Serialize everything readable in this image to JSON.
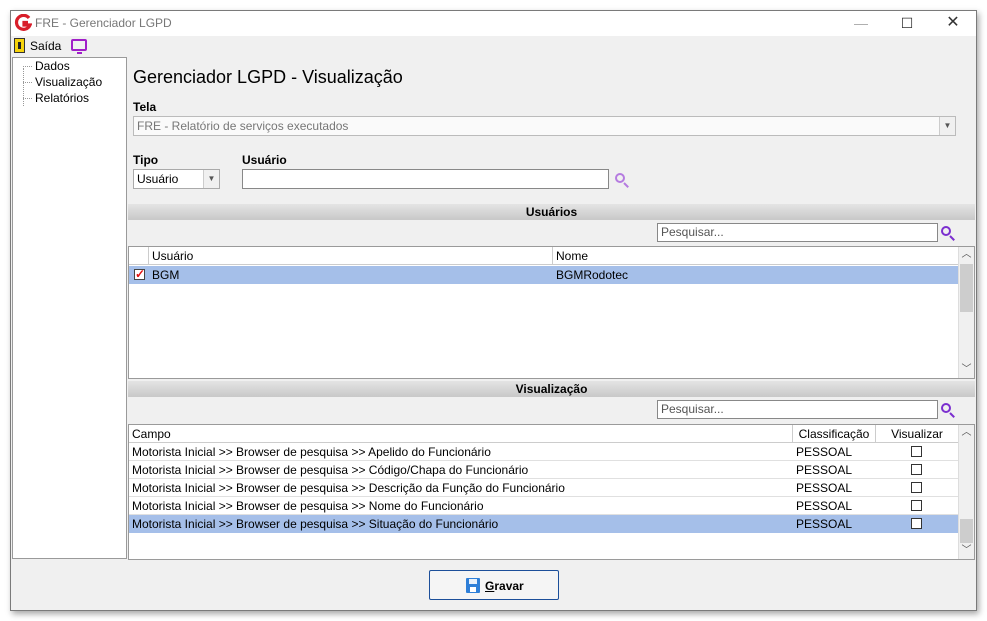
{
  "window": {
    "title": "FRE - Gerenciador LGPD"
  },
  "menu": {
    "exit_label": "Saída"
  },
  "sidebar": {
    "items": [
      {
        "label": "Dados"
      },
      {
        "label": "Visualização"
      },
      {
        "label": "Relatórios"
      }
    ]
  },
  "page": {
    "title": "Gerenciador LGPD - Visualização"
  },
  "tela": {
    "label": "Tela",
    "value": "FRE - Relatório de serviços executados"
  },
  "tipo": {
    "label": "Tipo",
    "value": "Usuário"
  },
  "usuario": {
    "label": "Usuário",
    "value": ""
  },
  "users_section": {
    "title": "Usuários",
    "search_placeholder": "Pesquisar...",
    "columns": [
      "Usuário",
      "Nome"
    ],
    "rows": [
      {
        "checked": true,
        "usuario": "BGM",
        "nome": "BGMRodotec"
      }
    ]
  },
  "view_section": {
    "title": "Visualização",
    "search_placeholder": "Pesquisar...",
    "columns": [
      "Campo",
      "Classificação",
      "Visualizar"
    ],
    "rows": [
      {
        "campo": "Motorista Inicial >> Browser de pesquisa >> Apelido do Funcionário",
        "classificacao": "PESSOAL",
        "visualizar": false
      },
      {
        "campo": "Motorista Inicial >> Browser de pesquisa >> Código/Chapa do Funcionário",
        "classificacao": "PESSOAL",
        "visualizar": false
      },
      {
        "campo": "Motorista Inicial >> Browser de pesquisa >> Descrição da Função do Funcionário",
        "classificacao": "PESSOAL",
        "visualizar": false
      },
      {
        "campo": "Motorista Inicial >> Browser de pesquisa >> Nome do Funcionário",
        "classificacao": "PESSOAL",
        "visualizar": false
      },
      {
        "campo": "Motorista Inicial >> Browser de pesquisa >> Situação do Funcionário",
        "classificacao": "PESSOAL",
        "visualizar": false
      }
    ]
  },
  "footer": {
    "save_label": "Gravar"
  },
  "colors": {
    "selection": "#a5bfe9",
    "accent": "#7b2fcf",
    "logo": "#d81e2a"
  }
}
